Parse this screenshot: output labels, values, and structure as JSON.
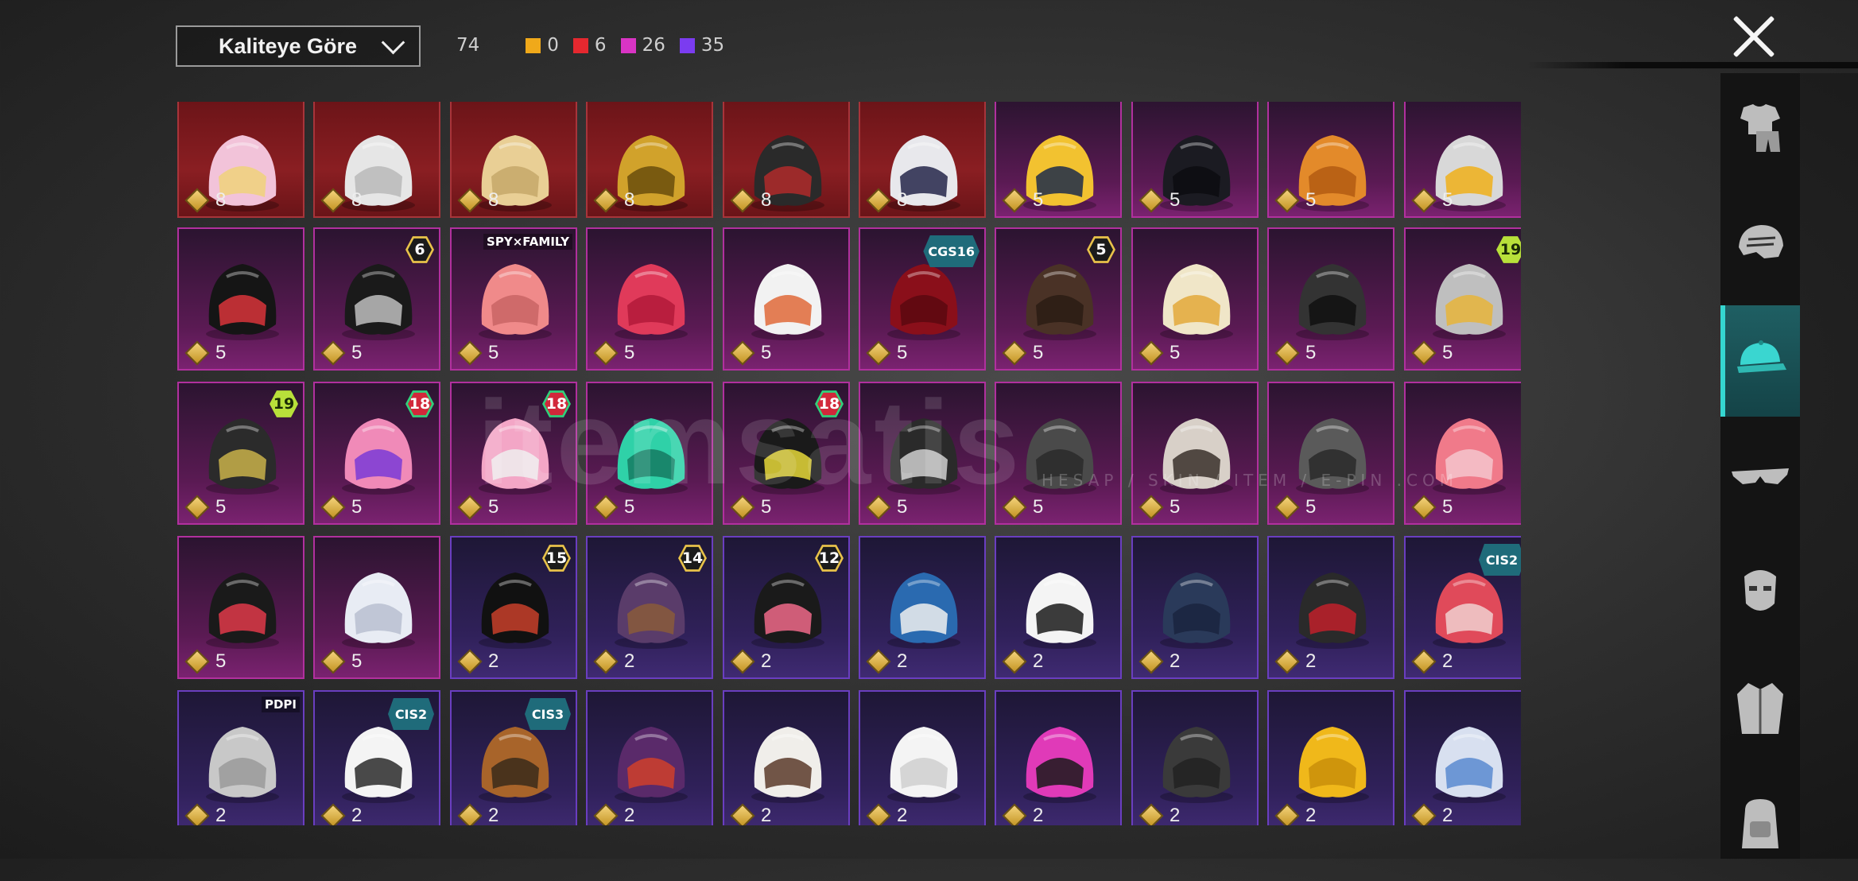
{
  "sort": {
    "label": "Kaliteye Göre"
  },
  "counts": {
    "total": "74",
    "tiers": [
      {
        "color": "#f0a91a",
        "value": "0"
      },
      {
        "color": "#e5282f",
        "value": "6"
      },
      {
        "color": "#d934c4",
        "value": "26"
      },
      {
        "color": "#7b3cf0",
        "value": "35"
      }
    ]
  },
  "sidebar": {
    "categories": [
      {
        "name": "outfit",
        "icon": "outfit-icon",
        "active": false
      },
      {
        "name": "helmet",
        "icon": "helmet-icon",
        "active": false
      },
      {
        "name": "hat",
        "icon": "cap-icon",
        "active": true
      },
      {
        "name": "glasses",
        "icon": "glasses-icon",
        "active": false
      },
      {
        "name": "mask",
        "icon": "mask-icon",
        "active": false
      },
      {
        "name": "jacket",
        "icon": "jacket-icon",
        "active": false
      },
      {
        "name": "backpack",
        "icon": "backpack-icon",
        "active": false
      }
    ]
  },
  "watermark": {
    "main": "itemsatis",
    "sub": "HESAP / SKIN / ITEM / E-PIN .COM"
  },
  "items": [
    {
      "tier": "red",
      "cost": "8",
      "badge": "",
      "art": "pink-hair"
    },
    {
      "tier": "red",
      "cost": "8",
      "badge": "",
      "art": "white-hair"
    },
    {
      "tier": "red",
      "cost": "8",
      "badge": "",
      "art": "blond-hair"
    },
    {
      "tier": "red",
      "cost": "8",
      "badge": "",
      "art": "gold-helm"
    },
    {
      "tier": "red",
      "cost": "8",
      "badge": "",
      "art": "demon-helm"
    },
    {
      "tier": "red",
      "cost": "8",
      "badge": "",
      "art": "white-helmet"
    },
    {
      "tier": "pink",
      "cost": "5",
      "badge": "",
      "art": "yellow-mascot"
    },
    {
      "tier": "pink",
      "cost": "5",
      "badge": "",
      "art": "black-fedora"
    },
    {
      "tier": "pink",
      "cost": "5",
      "badge": "",
      "art": "orange-hair"
    },
    {
      "tier": "pink",
      "cost": "5",
      "badge": "",
      "art": "visor-cap"
    },
    {
      "tier": "pink",
      "cost": "5",
      "badge": "",
      "art": "black-hair-bow"
    },
    {
      "tier": "pink",
      "cost": "5",
      "badge": "6",
      "badgeStyle": "dark",
      "art": "black-mask-helm"
    },
    {
      "tier": "pink",
      "cost": "5",
      "badge": "SPY×FAMILY",
      "badgeStyle": "tag",
      "art": "pink-hair-short"
    },
    {
      "tier": "pink",
      "cost": "5",
      "badge": "",
      "art": "red-hair-duo"
    },
    {
      "tier": "pink",
      "cost": "5",
      "badge": "",
      "art": "white-fox-hood"
    },
    {
      "tier": "pink",
      "cost": "5",
      "badge": "CGS16",
      "badgeStyle": "event",
      "art": "dark-red-hair"
    },
    {
      "tier": "pink",
      "cost": "5",
      "badge": "5",
      "badgeStyle": "dark",
      "art": "brown-pigtails"
    },
    {
      "tier": "pink",
      "cost": "5",
      "badge": "",
      "art": "box-head"
    },
    {
      "tier": "pink",
      "cost": "5",
      "badge": "",
      "art": "cat-helm"
    },
    {
      "tier": "pink",
      "cost": "5",
      "badge": "19",
      "badgeStyle": "yellow",
      "art": "silver-headphones"
    },
    {
      "tier": "pink",
      "cost": "5",
      "badge": "19",
      "badgeStyle": "yellow",
      "art": "bug-helm"
    },
    {
      "tier": "pink",
      "cost": "5",
      "badge": "18",
      "badgeStyle": "red",
      "art": "pink-hat-purple"
    },
    {
      "tier": "pink",
      "cost": "5",
      "badge": "18",
      "badgeStyle": "red",
      "art": "pink-hat-white"
    },
    {
      "tier": "pink",
      "cost": "5",
      "badge": "",
      "art": "green-ghost"
    },
    {
      "tier": "pink",
      "cost": "5",
      "badge": "18",
      "badgeStyle": "red",
      "art": "cap-headset"
    },
    {
      "tier": "pink",
      "cost": "5",
      "badge": "",
      "art": "bow-hair"
    },
    {
      "tier": "pink",
      "cost": "5",
      "badge": "",
      "art": "grey-hood"
    },
    {
      "tier": "pink",
      "cost": "5",
      "badge": "",
      "art": "skull-dreads"
    },
    {
      "tier": "pink",
      "cost": "5",
      "badge": "",
      "art": "grey-helm"
    },
    {
      "tier": "pink",
      "cost": "5",
      "badge": "",
      "art": "cake-hat"
    },
    {
      "tier": "pink",
      "cost": "5",
      "badge": "",
      "art": "wing-band"
    },
    {
      "tier": "pink",
      "cost": "5",
      "badge": "",
      "art": "white-bucket"
    },
    {
      "tier": "purple",
      "cost": "2",
      "badge": "15",
      "badgeStyle": "dark",
      "art": "black-beanie-red"
    },
    {
      "tier": "purple",
      "cost": "2",
      "badge": "14",
      "badgeStyle": "dark",
      "art": "cat-ears-long"
    },
    {
      "tier": "purple",
      "cost": "2",
      "badge": "12",
      "badgeStyle": "dark",
      "art": "bunny-ears"
    },
    {
      "tier": "purple",
      "cost": "2",
      "badge": "",
      "art": "blue-cap"
    },
    {
      "tier": "purple",
      "cost": "2",
      "badge": "",
      "art": "white-sunhat"
    },
    {
      "tier": "purple",
      "cost": "2",
      "badge": "",
      "art": "navy-cap"
    },
    {
      "tier": "purple",
      "cost": "2",
      "badge": "",
      "art": "bucket-red-hair"
    },
    {
      "tier": "purple",
      "cost": "2",
      "badge": "CIS2",
      "badgeStyle": "event",
      "art": "red-beanie"
    },
    {
      "tier": "purple",
      "cost": "2",
      "badge": "PDPI",
      "badgeStyle": "tag",
      "art": "silver-bob"
    },
    {
      "tier": "purple",
      "cost": "2",
      "badge": "CIS2",
      "badgeStyle": "event",
      "art": "chef-gasmask"
    },
    {
      "tier": "purple",
      "cost": "2",
      "badge": "CIS3",
      "badgeStyle": "event",
      "art": "barrel-lamp"
    },
    {
      "tier": "purple",
      "cost": "2",
      "badge": "",
      "art": "purple-witch"
    },
    {
      "tier": "purple",
      "cost": "2",
      "badge": "",
      "art": "clown-mask"
    },
    {
      "tier": "purple",
      "cost": "2",
      "badge": "",
      "art": "white-cap-cloth"
    },
    {
      "tier": "purple",
      "cost": "2",
      "badge": "",
      "art": "pink-spike-helm"
    },
    {
      "tier": "purple",
      "cost": "2",
      "badge": "",
      "art": "dark-cap"
    },
    {
      "tier": "purple",
      "cost": "2",
      "badge": "",
      "art": "yellow-bucket"
    },
    {
      "tier": "purple",
      "cost": "2",
      "badge": "",
      "art": "bobble-beanie"
    }
  ]
}
